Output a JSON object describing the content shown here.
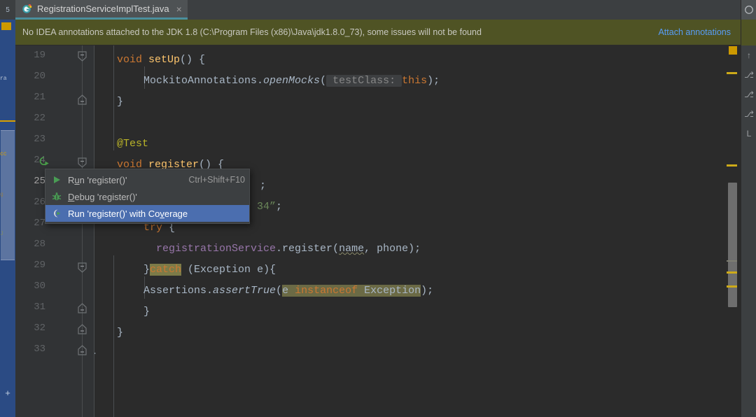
{
  "window": {
    "left_strip_label": "5",
    "left_strip_text_1": "ra",
    "left_strip_text_2": "cc",
    "left_strip_text_3": "g",
    "left_strip_text_4": "J",
    "left_strip_plus": "+"
  },
  "tab": {
    "label": "RegistrationServiceImplTest.java",
    "icon": "java-test-class-icon",
    "close": "×"
  },
  "notification": {
    "message": "No IDEA annotations attached to the JDK 1.8 (C:\\Program Files (x86)\\Java\\jdk1.8.0_73), some issues will not be found",
    "link": "Attach annotations",
    "gear_icon": "gear-icon",
    "background": "#4f5324",
    "link_color": "#589df6"
  },
  "editor": {
    "line_numbers": [
      "19",
      "20",
      "21",
      "22",
      "23",
      "24",
      "25",
      "26",
      "27",
      "28",
      "29",
      "30",
      "31",
      "32",
      "33"
    ],
    "current_line": "25",
    "lines": [
      {
        "n": "19",
        "text": "void setUp() {"
      },
      {
        "n": "20",
        "text": "MockitoAnnotations.openMocks( testClass: this);"
      },
      {
        "n": "21",
        "text": "}"
      },
      {
        "n": "22",
        "text": ""
      },
      {
        "n": "23",
        "text": "@Test"
      },
      {
        "n": "24",
        "text": "void register() {"
      },
      {
        "n": "25",
        "text": ";"
      },
      {
        "n": "26",
        "text": "34\";"
      },
      {
        "n": "27",
        "text": "try {"
      },
      {
        "n": "28",
        "text": "registrationService.register(name, phone);"
      },
      {
        "n": "29",
        "text": "}catch (Exception e){"
      },
      {
        "n": "30",
        "text": "Assertions.assertTrue(e instanceof Exception);"
      },
      {
        "n": "31",
        "text": "}"
      },
      {
        "n": "32",
        "text": "}"
      },
      {
        "n": "33",
        "text": "}"
      }
    ],
    "tokens": {
      "kw_void": "void",
      "kw_this": "this",
      "kw_try": "try",
      "kw_catch": "catch",
      "kw_instanceof": "instanceof",
      "method_setUp": "setUp",
      "method_register": "register",
      "method_openMocks": "openMocks",
      "method_assertTrue": "assertTrue",
      "class_MockitoAnnotations": "MockitoAnnotations",
      "class_Assertions": "Assertions",
      "class_Exception": "Exception",
      "field_registrationService": "registrationService",
      "param_name": "name",
      "param_phone": "phone",
      "param_e": "e",
      "annotation_Test": "@Test",
      "hint_testClass": "testClass:",
      "str_fragment": "34\"",
      "semicolon": ";",
      "brace_open": "{",
      "brace_close": "}",
      "paren_empty": "()"
    },
    "colors": {
      "background": "#2b2b2b",
      "gutter": "#313335",
      "text": "#a9b7c6",
      "keyword": "#cc7832",
      "method": "#ffc66d",
      "string": "#6a8759",
      "annotation": "#bbb529",
      "field": "#9876aa",
      "line_number": "#606366",
      "current_line_number": "#a4a3a3",
      "highlight_band": "#6b6a45"
    }
  },
  "context_menu": {
    "items": [
      {
        "label": "Run 'register()'",
        "label_pre": "R",
        "label_mnemonic": "u",
        "label_post": "n 'register()'",
        "shortcut": "Ctrl+Shift+F10",
        "icon": "run-play-icon",
        "selected": false
      },
      {
        "label": "Debug 'register()'",
        "label_pre": "",
        "label_mnemonic": "D",
        "label_post": "ebug 'register()'",
        "shortcut": "",
        "icon": "debug-bug-icon",
        "selected": false
      },
      {
        "label": "Run 'register()' with Coverage",
        "label_pre": "Run 'register()' with Co",
        "label_mnemonic": "v",
        "label_post": "erage",
        "shortcut": "",
        "icon": "coverage-icon",
        "selected": true
      }
    ],
    "selected_color": "#4b6eaf"
  },
  "gutter_run_icon": {
    "name": "run-test-gutter-icon",
    "line": "24",
    "color": "#4a9e4a"
  },
  "right_toolstrip": {
    "items": [
      "↑",
      "⎇",
      "⎇",
      "⎇",
      "L"
    ]
  }
}
